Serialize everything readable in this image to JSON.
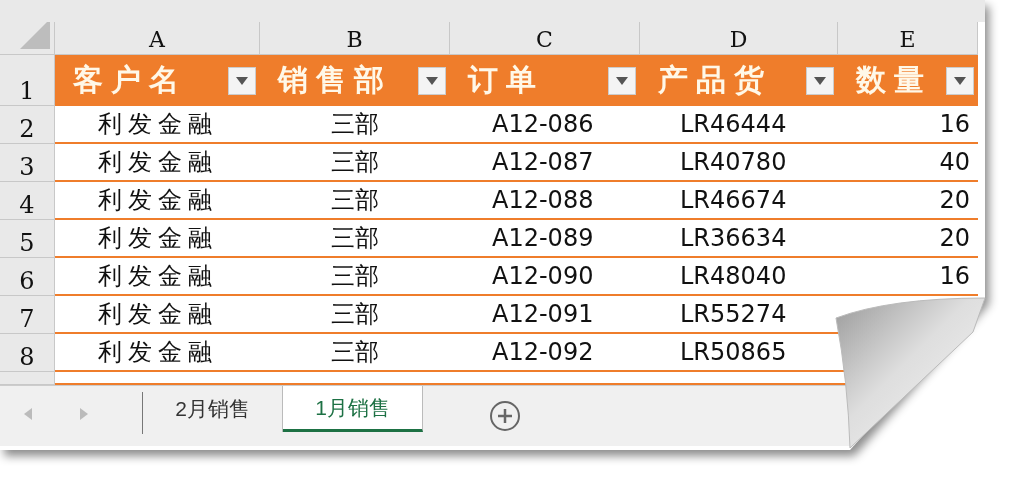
{
  "column_headers": [
    "A",
    "B",
    "C",
    "D",
    "E"
  ],
  "header_row": {
    "row_number": "1",
    "cells": [
      {
        "label": "客户名"
      },
      {
        "label": "销售部"
      },
      {
        "label": "订单"
      },
      {
        "label": "产品货"
      },
      {
        "label": "数量"
      }
    ]
  },
  "rows": [
    {
      "row_number": "2",
      "cells": [
        "利发金融",
        "三部",
        "A12-086",
        "LR46444",
        "16"
      ]
    },
    {
      "row_number": "3",
      "cells": [
        "利发金融",
        "三部",
        "A12-087",
        "LR40780",
        "40"
      ]
    },
    {
      "row_number": "4",
      "cells": [
        "利发金融",
        "三部",
        "A12-088",
        "LR46674",
        "20"
      ]
    },
    {
      "row_number": "5",
      "cells": [
        "利发金融",
        "三部",
        "A12-089",
        "LR36634",
        "20"
      ]
    },
    {
      "row_number": "6",
      "cells": [
        "利发金融",
        "三部",
        "A12-090",
        "LR48040",
        "16"
      ]
    },
    {
      "row_number": "7",
      "cells": [
        "利发金融",
        "三部",
        "A12-091",
        "LR55274"
      ]
    },
    {
      "row_number": "8",
      "cells": [
        "利发金融",
        "三部",
        "A12-092",
        "LR50865"
      ]
    }
  ],
  "sheet_tabs": [
    {
      "label": "2月销售",
      "selected": false
    },
    {
      "label": "1月销售",
      "selected": true
    }
  ]
}
